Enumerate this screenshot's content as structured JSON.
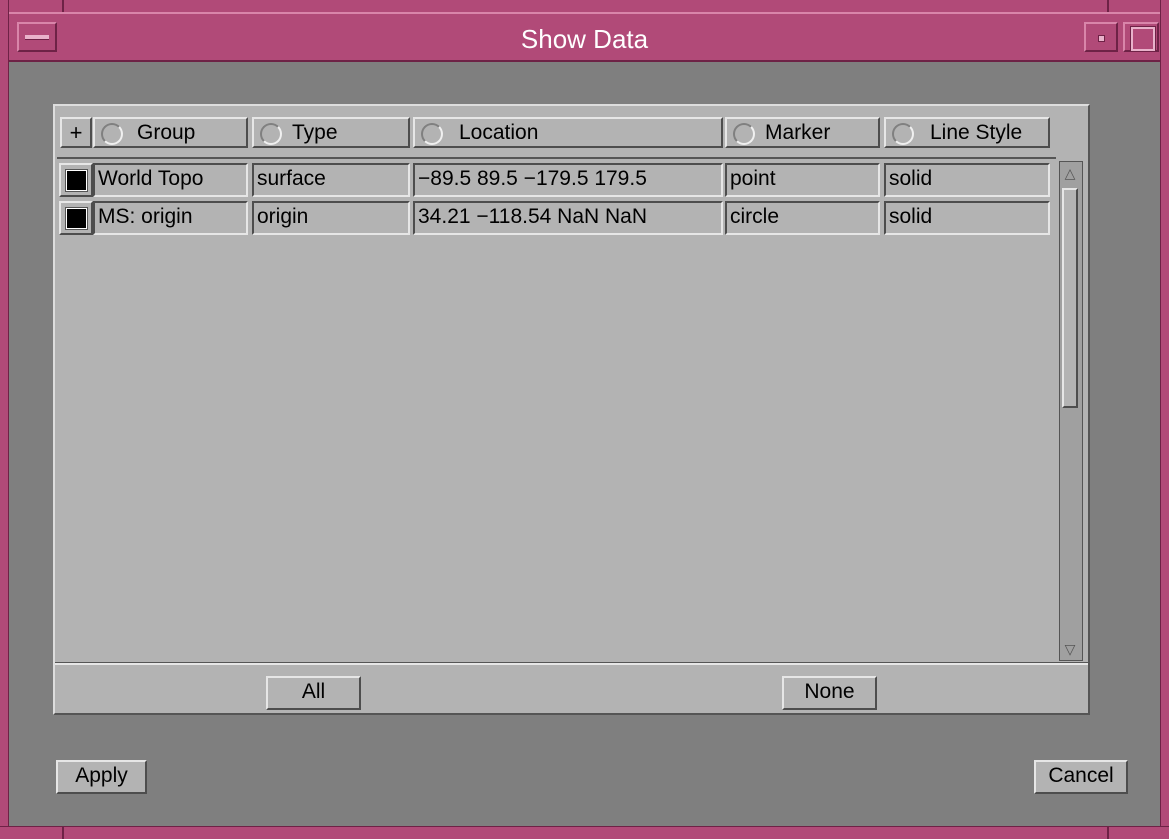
{
  "window": {
    "title": "Show Data"
  },
  "table": {
    "add_label": "+",
    "headers": [
      "Group",
      "Type",
      "Location",
      "Marker",
      "Line Style"
    ],
    "rows": [
      {
        "group": "World Topo",
        "type": "surface",
        "location": "−89.5 89.5 −179.5 179.5",
        "marker": "point",
        "line_style": "solid"
      },
      {
        "group": "MS: origin",
        "type": "origin",
        "location": "34.21 −118.54 NaN NaN",
        "marker": "circle",
        "line_style": "solid"
      }
    ]
  },
  "buttons": {
    "all": "All",
    "none": "None",
    "apply": "Apply",
    "cancel": "Cancel"
  },
  "colors": {
    "frame": "#b14a78",
    "background": "#7f7f7f",
    "panel": "#b3b3b3"
  },
  "icons": {
    "window_menu": "window-menu-icon",
    "minimize": "minimize-icon",
    "maximize": "maximize-icon"
  }
}
